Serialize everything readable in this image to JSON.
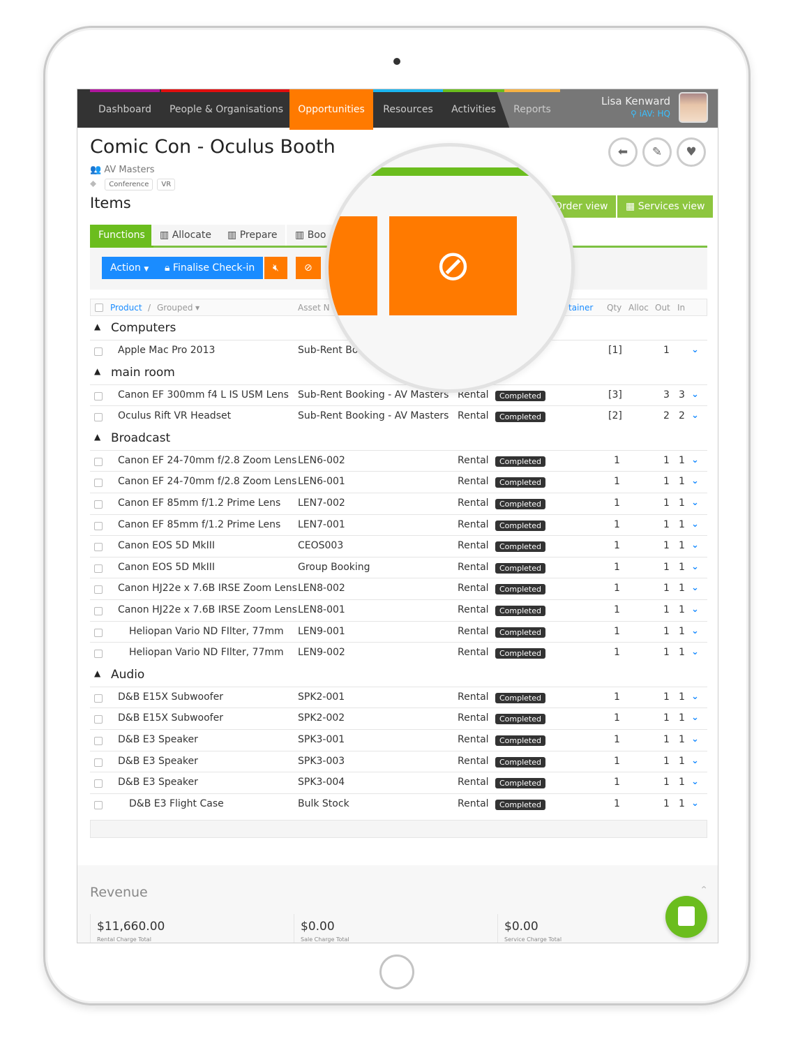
{
  "nav": {
    "items": [
      {
        "label": "Dashboard",
        "color": "#b0179e"
      },
      {
        "label": "People & Organisations",
        "color": "#e10f0f"
      },
      {
        "label": "Opportunities",
        "color": "#ff7a00"
      },
      {
        "label": "Resources",
        "color": "#1cb6f0"
      },
      {
        "label": "Activities",
        "color": "#6bbd1e"
      },
      {
        "label": "Reports",
        "color": "#f7b244"
      }
    ],
    "user_name": "Lisa Kenward",
    "location": "iAV: HQ"
  },
  "page": {
    "title": "Comic Con - Oculus Booth",
    "organisation": "AV Masters",
    "tags": [
      "Conference",
      "VR"
    ],
    "items_heading": "Items"
  },
  "views": {
    "order": "Order view",
    "services": "Services view"
  },
  "tabs": [
    "Functions",
    "Allocate",
    "Prepare",
    "Boo"
  ],
  "toolbar": {
    "action": "Action",
    "finalise": "Finalise Check-in"
  },
  "table": {
    "headers": {
      "product": "Product",
      "grouped": "Grouped",
      "asset": "Asset N",
      "container": "tainer",
      "qty": "Qty",
      "alloc": "Alloc",
      "out": "Out",
      "in": "In"
    },
    "groups": [
      {
        "name": "Computers",
        "rows": [
          {
            "product": "Apple Mac Pro 2013",
            "asset": "Sub-Rent Bo",
            "type": "",
            "status": "",
            "qty": "[1]",
            "out": "1",
            "in": ""
          }
        ]
      },
      {
        "name": "main room",
        "rows": [
          {
            "product": "Canon EF 300mm f4 L IS USM Lens",
            "asset": "Sub-Rent Booking - AV Masters",
            "type": "Rental",
            "status": "Completed",
            "qty": "[3]",
            "out": "3",
            "in": "3"
          },
          {
            "product": "Oculus Rift VR Headset",
            "asset": "Sub-Rent Booking - AV Masters",
            "type": "Rental",
            "status": "Completed",
            "qty": "[2]",
            "out": "2",
            "in": "2"
          }
        ]
      },
      {
        "name": "Broadcast",
        "rows": [
          {
            "product": "Canon EF 24-70mm f/2.8 Zoom Lens",
            "asset": "LEN6-002",
            "type": "Rental",
            "status": "Completed",
            "qty": "1",
            "out": "1",
            "in": "1"
          },
          {
            "product": "Canon EF 24-70mm f/2.8 Zoom Lens",
            "asset": "LEN6-001",
            "type": "Rental",
            "status": "Completed",
            "qty": "1",
            "out": "1",
            "in": "1"
          },
          {
            "product": "Canon EF 85mm f/1.2 Prime Lens",
            "asset": "LEN7-002",
            "type": "Rental",
            "status": "Completed",
            "qty": "1",
            "out": "1",
            "in": "1"
          },
          {
            "product": "Canon EF 85mm f/1.2 Prime Lens",
            "asset": "LEN7-001",
            "type": "Rental",
            "status": "Completed",
            "qty": "1",
            "out": "1",
            "in": "1"
          },
          {
            "product": "Canon EOS 5D MkIII",
            "asset": "CEOS003",
            "type": "Rental",
            "status": "Completed",
            "qty": "1",
            "out": "1",
            "in": "1"
          },
          {
            "product": "Canon EOS 5D MkIII",
            "asset": "Group Booking",
            "type": "Rental",
            "status": "Completed",
            "qty": "1",
            "out": "1",
            "in": "1"
          },
          {
            "product": "Canon HJ22e x 7.6B IRSE Zoom Lens",
            "asset": "LEN8-002",
            "type": "Rental",
            "status": "Completed",
            "qty": "1",
            "out": "1",
            "in": "1"
          },
          {
            "product": "Canon HJ22e x 7.6B IRSE Zoom Lens",
            "asset": "LEN8-001",
            "type": "Rental",
            "status": "Completed",
            "qty": "1",
            "out": "1",
            "in": "1"
          },
          {
            "product": "Heliopan Vario ND FIlter, 77mm",
            "asset": "LEN9-001",
            "type": "Rental",
            "status": "Completed",
            "qty": "1",
            "out": "1",
            "in": "1",
            "indent": true
          },
          {
            "product": "Heliopan Vario ND FIlter, 77mm",
            "asset": "LEN9-002",
            "type": "Rental",
            "status": "Completed",
            "qty": "1",
            "out": "1",
            "in": "1",
            "indent": true
          }
        ]
      },
      {
        "name": "Audio",
        "rows": [
          {
            "product": "D&B E15X Subwoofer",
            "asset": "SPK2-001",
            "type": "Rental",
            "status": "Completed",
            "qty": "1",
            "out": "1",
            "in": "1"
          },
          {
            "product": "D&B E15X Subwoofer",
            "asset": "SPK2-002",
            "type": "Rental",
            "status": "Completed",
            "qty": "1",
            "out": "1",
            "in": "1"
          },
          {
            "product": "D&B E3 Speaker",
            "asset": "SPK3-001",
            "type": "Rental",
            "status": "Completed",
            "qty": "1",
            "out": "1",
            "in": "1"
          },
          {
            "product": "D&B E3 Speaker",
            "asset": "SPK3-003",
            "type": "Rental",
            "status": "Completed",
            "qty": "1",
            "out": "1",
            "in": "1"
          },
          {
            "product": "D&B E3 Speaker",
            "asset": "SPK3-004",
            "type": "Rental",
            "status": "Completed",
            "qty": "1",
            "out": "1",
            "in": "1"
          },
          {
            "product": "D&B E3 Flight Case",
            "asset": "Bulk Stock",
            "type": "Rental",
            "status": "Completed",
            "qty": "1",
            "out": "1",
            "in": "1",
            "indent": true
          }
        ]
      }
    ]
  },
  "revenue": {
    "heading": "Revenue",
    "cards": [
      {
        "value": "$11,660.00",
        "label": "Rental Charge Total"
      },
      {
        "value": "$0.00",
        "label": "Sale Charge Total"
      },
      {
        "value": "$0.00",
        "label": "Service Charge Total"
      }
    ]
  },
  "colors": {
    "accent": "#ff7a00",
    "primary": "#1a8cff",
    "success": "#6bbd1e"
  }
}
